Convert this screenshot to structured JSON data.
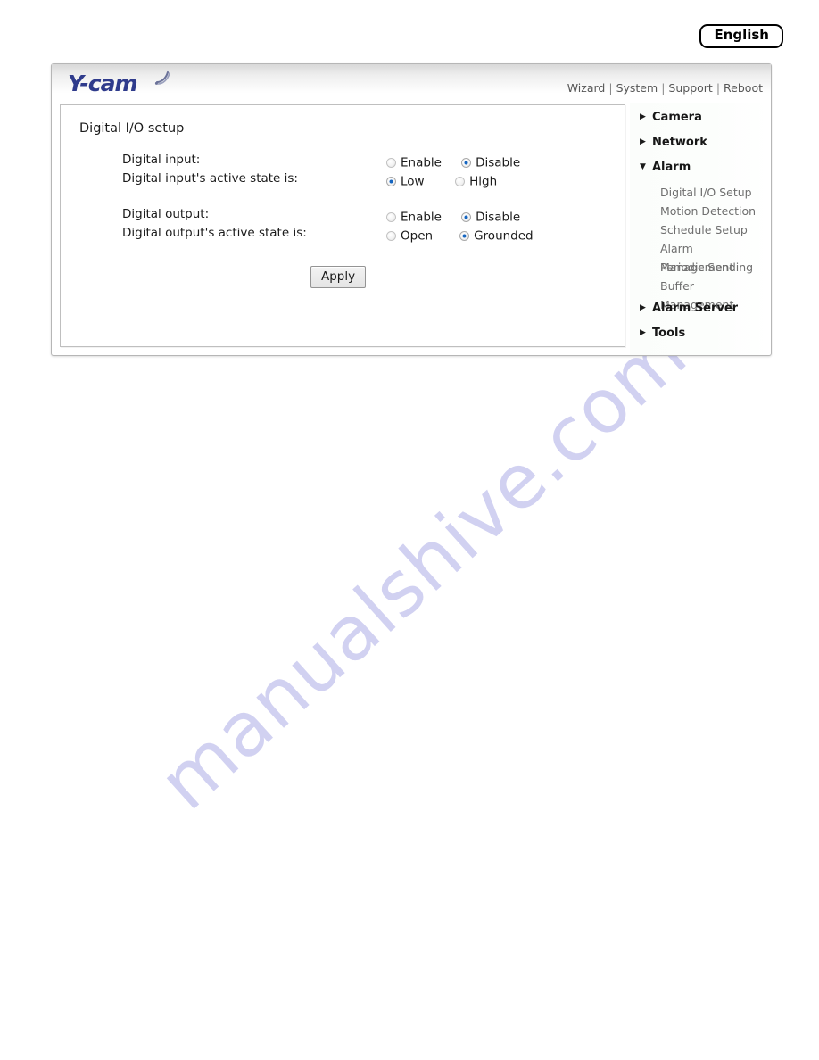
{
  "language_badge": {
    "label": "English"
  },
  "header": {
    "logo_text": "Y-cam",
    "logo_icon": "wifi-arc-icon",
    "nav": [
      {
        "label": "Wizard"
      },
      {
        "label": "System"
      },
      {
        "label": "Support"
      },
      {
        "label": "Reboot"
      }
    ],
    "nav_separator": "|"
  },
  "content": {
    "panel_title": "Digital I/O setup",
    "rows": [
      {
        "label": "Digital input:",
        "options": [
          {
            "label": "Enable",
            "checked": false
          },
          {
            "label": "Disable",
            "checked": true
          }
        ]
      },
      {
        "label": "Digital input's active state is:",
        "options": [
          {
            "label": "Low",
            "checked": true
          },
          {
            "label": "High",
            "checked": false
          }
        ]
      },
      {
        "label": "Digital output:",
        "options": [
          {
            "label": "Enable",
            "checked": false
          },
          {
            "label": "Disable",
            "checked": true
          }
        ]
      },
      {
        "label": "Digital output's active state is:",
        "options": [
          {
            "label": "Open",
            "checked": false
          },
          {
            "label": "Grounded",
            "checked": true
          }
        ]
      }
    ],
    "apply_label": "Apply"
  },
  "sidebar": {
    "groups": [
      {
        "label": "Camera",
        "expanded": false,
        "caret": "▶"
      },
      {
        "label": "Network",
        "expanded": false,
        "caret": "▶"
      },
      {
        "label": "Alarm",
        "expanded": true,
        "caret": "▼"
      },
      {
        "label": "Alarm Server",
        "expanded": false,
        "caret": "▶"
      },
      {
        "label": "Tools",
        "expanded": false,
        "caret": "▶"
      }
    ],
    "alarm_items": [
      {
        "label": "Digital I/O Setup"
      },
      {
        "label": "Motion Detection"
      },
      {
        "label": "Schedule Setup"
      },
      {
        "label": "Alarm Management"
      },
      {
        "label": "Periodic Sending"
      },
      {
        "label": "Buffer Management"
      }
    ]
  },
  "watermark": {
    "text": "manualshive.com",
    "color": "#c9c9ef"
  },
  "colors": {
    "logo": "#2f3b8c",
    "radio_selected": "#1565c0",
    "nav_text": "#575757",
    "sidebar_sub_text": "#6f6f6f"
  }
}
